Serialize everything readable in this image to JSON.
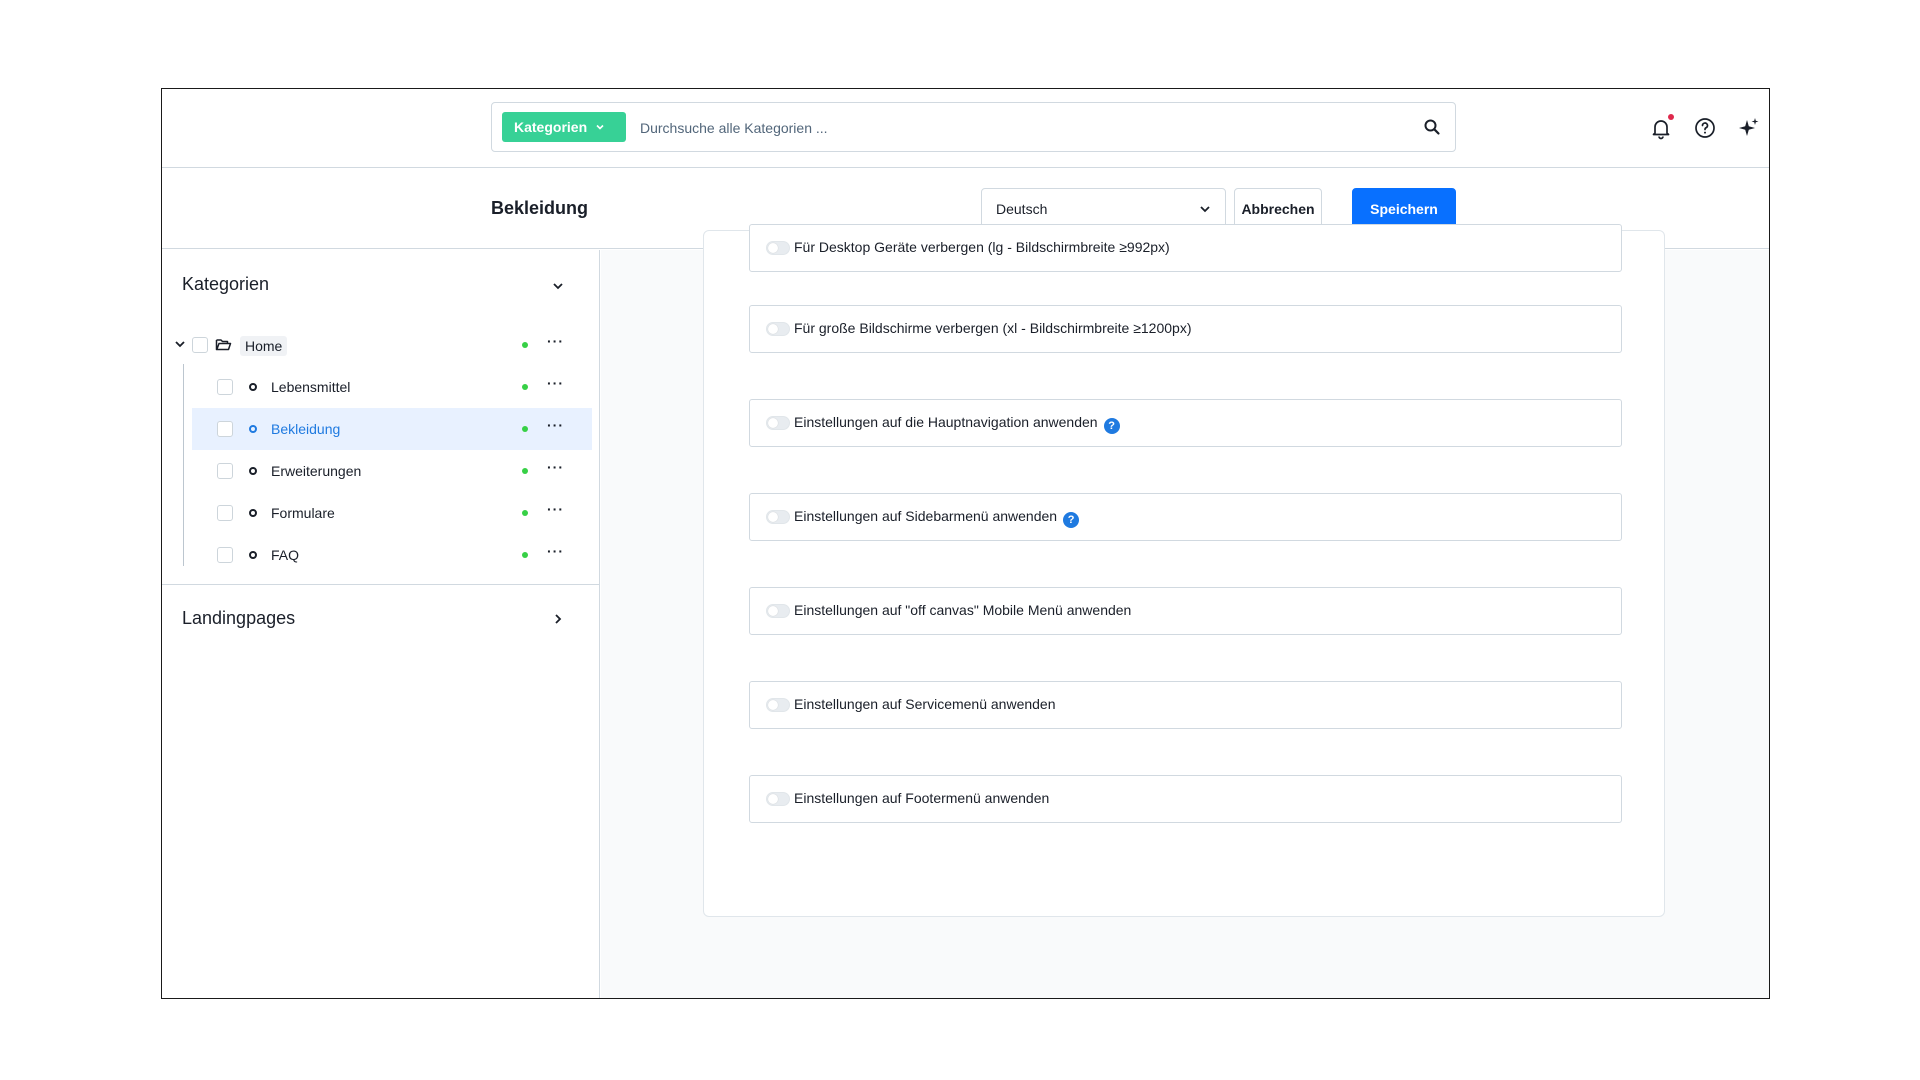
{
  "header": {
    "search_type": "Kategorien",
    "search_placeholder": "Durchsuche alle Kategorien ..."
  },
  "smartbar": {
    "title": "Bekleidung",
    "language": "Deutsch",
    "cancel_label": "Abbrechen",
    "save_label": "Speichern"
  },
  "sidebar": {
    "categories_title": "Kategorien",
    "root": "Home",
    "items": [
      "Lebensmittel",
      "Bekleidung",
      "Erweiterungen",
      "Formulare",
      "FAQ"
    ],
    "active_item": "Bekleidung",
    "landingpages_title": "Landingpages"
  },
  "options": [
    {
      "label": "Für Desktop Geräte verbergen (lg - Bildschirmbreite ≥992px)",
      "help": false
    },
    {
      "label": "Für große Bildschirme verbergen (xl - Bildschirmbreite ≥1200px)",
      "help": false
    },
    {
      "label": "Einstellungen auf die Hauptnavigation anwenden",
      "help": true
    },
    {
      "label": "Einstellungen auf Sidebarmenü anwenden",
      "help": true
    },
    {
      "label": "Einstellungen auf \"off canvas\" Mobile Menü anwenden",
      "help": false
    },
    {
      "label": "Einstellungen auf Servicemenü anwenden",
      "help": false
    },
    {
      "label": "Einstellungen auf Footermenü anwenden",
      "help": false
    }
  ],
  "help_symbol": "?",
  "colors": {
    "accent": "#0870ff",
    "search_type": "#37d196",
    "status_active": "#37d046",
    "notification": "#de294c"
  }
}
